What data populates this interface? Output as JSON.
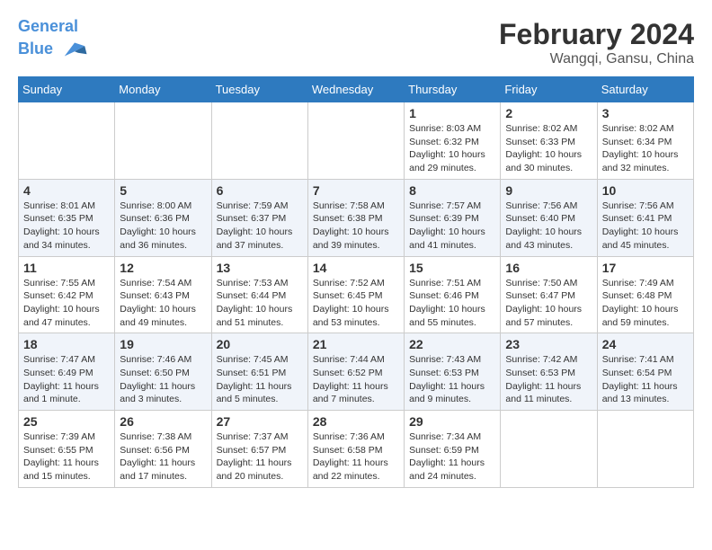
{
  "header": {
    "logo_line1": "General",
    "logo_line2": "Blue",
    "month_title": "February 2024",
    "location": "Wangqi, Gansu, China"
  },
  "weekdays": [
    "Sunday",
    "Monday",
    "Tuesday",
    "Wednesday",
    "Thursday",
    "Friday",
    "Saturday"
  ],
  "weeks": [
    [
      {
        "day": "",
        "info": ""
      },
      {
        "day": "",
        "info": ""
      },
      {
        "day": "",
        "info": ""
      },
      {
        "day": "",
        "info": ""
      },
      {
        "day": "1",
        "info": "Sunrise: 8:03 AM\nSunset: 6:32 PM\nDaylight: 10 hours and 29 minutes."
      },
      {
        "day": "2",
        "info": "Sunrise: 8:02 AM\nSunset: 6:33 PM\nDaylight: 10 hours and 30 minutes."
      },
      {
        "day": "3",
        "info": "Sunrise: 8:02 AM\nSunset: 6:34 PM\nDaylight: 10 hours and 32 minutes."
      }
    ],
    [
      {
        "day": "4",
        "info": "Sunrise: 8:01 AM\nSunset: 6:35 PM\nDaylight: 10 hours and 34 minutes."
      },
      {
        "day": "5",
        "info": "Sunrise: 8:00 AM\nSunset: 6:36 PM\nDaylight: 10 hours and 36 minutes."
      },
      {
        "day": "6",
        "info": "Sunrise: 7:59 AM\nSunset: 6:37 PM\nDaylight: 10 hours and 37 minutes."
      },
      {
        "day": "7",
        "info": "Sunrise: 7:58 AM\nSunset: 6:38 PM\nDaylight: 10 hours and 39 minutes."
      },
      {
        "day": "8",
        "info": "Sunrise: 7:57 AM\nSunset: 6:39 PM\nDaylight: 10 hours and 41 minutes."
      },
      {
        "day": "9",
        "info": "Sunrise: 7:56 AM\nSunset: 6:40 PM\nDaylight: 10 hours and 43 minutes."
      },
      {
        "day": "10",
        "info": "Sunrise: 7:56 AM\nSunset: 6:41 PM\nDaylight: 10 hours and 45 minutes."
      }
    ],
    [
      {
        "day": "11",
        "info": "Sunrise: 7:55 AM\nSunset: 6:42 PM\nDaylight: 10 hours and 47 minutes."
      },
      {
        "day": "12",
        "info": "Sunrise: 7:54 AM\nSunset: 6:43 PM\nDaylight: 10 hours and 49 minutes."
      },
      {
        "day": "13",
        "info": "Sunrise: 7:53 AM\nSunset: 6:44 PM\nDaylight: 10 hours and 51 minutes."
      },
      {
        "day": "14",
        "info": "Sunrise: 7:52 AM\nSunset: 6:45 PM\nDaylight: 10 hours and 53 minutes."
      },
      {
        "day": "15",
        "info": "Sunrise: 7:51 AM\nSunset: 6:46 PM\nDaylight: 10 hours and 55 minutes."
      },
      {
        "day": "16",
        "info": "Sunrise: 7:50 AM\nSunset: 6:47 PM\nDaylight: 10 hours and 57 minutes."
      },
      {
        "day": "17",
        "info": "Sunrise: 7:49 AM\nSunset: 6:48 PM\nDaylight: 10 hours and 59 minutes."
      }
    ],
    [
      {
        "day": "18",
        "info": "Sunrise: 7:47 AM\nSunset: 6:49 PM\nDaylight: 11 hours and 1 minute."
      },
      {
        "day": "19",
        "info": "Sunrise: 7:46 AM\nSunset: 6:50 PM\nDaylight: 11 hours and 3 minutes."
      },
      {
        "day": "20",
        "info": "Sunrise: 7:45 AM\nSunset: 6:51 PM\nDaylight: 11 hours and 5 minutes."
      },
      {
        "day": "21",
        "info": "Sunrise: 7:44 AM\nSunset: 6:52 PM\nDaylight: 11 hours and 7 minutes."
      },
      {
        "day": "22",
        "info": "Sunrise: 7:43 AM\nSunset: 6:53 PM\nDaylight: 11 hours and 9 minutes."
      },
      {
        "day": "23",
        "info": "Sunrise: 7:42 AM\nSunset: 6:53 PM\nDaylight: 11 hours and 11 minutes."
      },
      {
        "day": "24",
        "info": "Sunrise: 7:41 AM\nSunset: 6:54 PM\nDaylight: 11 hours and 13 minutes."
      }
    ],
    [
      {
        "day": "25",
        "info": "Sunrise: 7:39 AM\nSunset: 6:55 PM\nDaylight: 11 hours and 15 minutes."
      },
      {
        "day": "26",
        "info": "Sunrise: 7:38 AM\nSunset: 6:56 PM\nDaylight: 11 hours and 17 minutes."
      },
      {
        "day": "27",
        "info": "Sunrise: 7:37 AM\nSunset: 6:57 PM\nDaylight: 11 hours and 20 minutes."
      },
      {
        "day": "28",
        "info": "Sunrise: 7:36 AM\nSunset: 6:58 PM\nDaylight: 11 hours and 22 minutes."
      },
      {
        "day": "29",
        "info": "Sunrise: 7:34 AM\nSunset: 6:59 PM\nDaylight: 11 hours and 24 minutes."
      },
      {
        "day": "",
        "info": ""
      },
      {
        "day": "",
        "info": ""
      }
    ]
  ]
}
